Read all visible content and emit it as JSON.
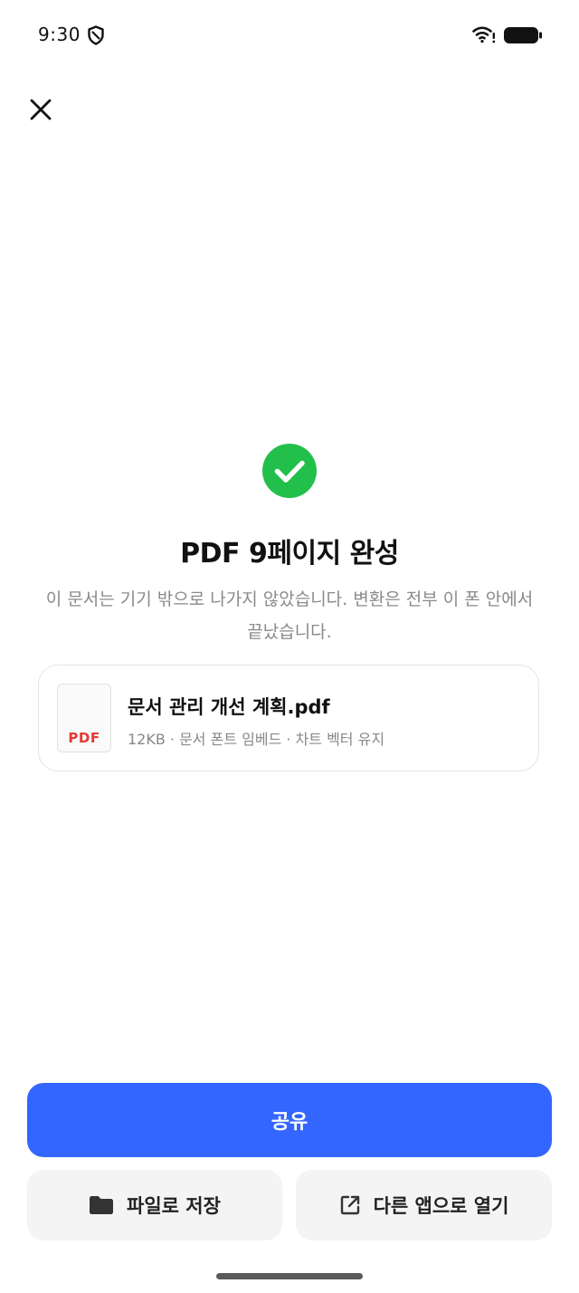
{
  "status_bar": {
    "time": "9:30",
    "icons": [
      "shield-icon",
      "wifi-icon",
      "battery-icon"
    ]
  },
  "header": {
    "close_icon": "close-icon"
  },
  "result": {
    "icon": "check-circle-icon",
    "icon_color": "#22c04a",
    "title": "PDF 9페이지 완성",
    "subtitle": "이 문서는 기기 밖으로 나가지 않았습니다. 변환은 전부 이 폰 안에서 끝났습니다."
  },
  "file": {
    "thumb_label": "PDF",
    "name": "문서 관리 개선 계획.pdf",
    "meta": "12KB · 문서 폰트 임베드 · 차트 벡터 유지"
  },
  "actions": {
    "share_label": "공유",
    "share_color": "#3366ff",
    "save_label": "파일로 저장",
    "save_icon": "folder-icon",
    "open_label": "다른 앱으로 열기",
    "open_icon": "open-external-icon"
  }
}
